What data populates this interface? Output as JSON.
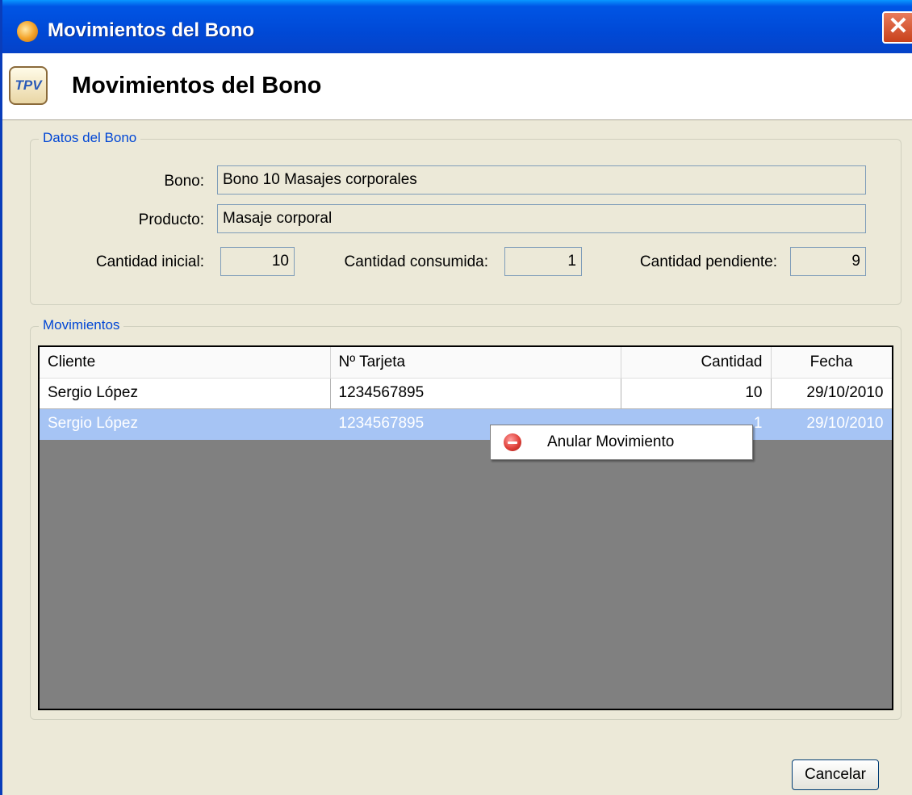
{
  "window": {
    "title": "Movimientos del Bono",
    "close_glyph": "✕"
  },
  "header": {
    "title": "Movimientos del Bono",
    "icon_text": "TPV"
  },
  "datos": {
    "legend": "Datos del Bono",
    "bono_label": "Bono:",
    "bono_value": "Bono 10 Masajes corporales",
    "producto_label": "Producto:",
    "producto_value": "Masaje corporal",
    "cantidad_inicial_label": "Cantidad inicial:",
    "cantidad_inicial_value": "10",
    "cantidad_consumida_label": "Cantidad consumida:",
    "cantidad_consumida_value": "1",
    "cantidad_pendiente_label": "Cantidad pendiente:",
    "cantidad_pendiente_value": "9"
  },
  "movimientos": {
    "legend": "Movimientos",
    "columns": [
      "Cliente",
      "Nº Tarjeta",
      "Cantidad",
      "Fecha"
    ],
    "rows": [
      {
        "cliente": "Sergio López",
        "tarjeta": "1234567895",
        "cantidad": "10",
        "fecha": "29/10/2010"
      },
      {
        "cliente": "Sergio López",
        "tarjeta": "1234567895",
        "cantidad": "1",
        "fecha": "29/10/2010"
      }
    ],
    "selected_row": 1
  },
  "context_menu": {
    "item_label": "Anular Movimiento",
    "item_icon": "remove-icon"
  },
  "footer": {
    "cancel_label": "Cancelar"
  }
}
